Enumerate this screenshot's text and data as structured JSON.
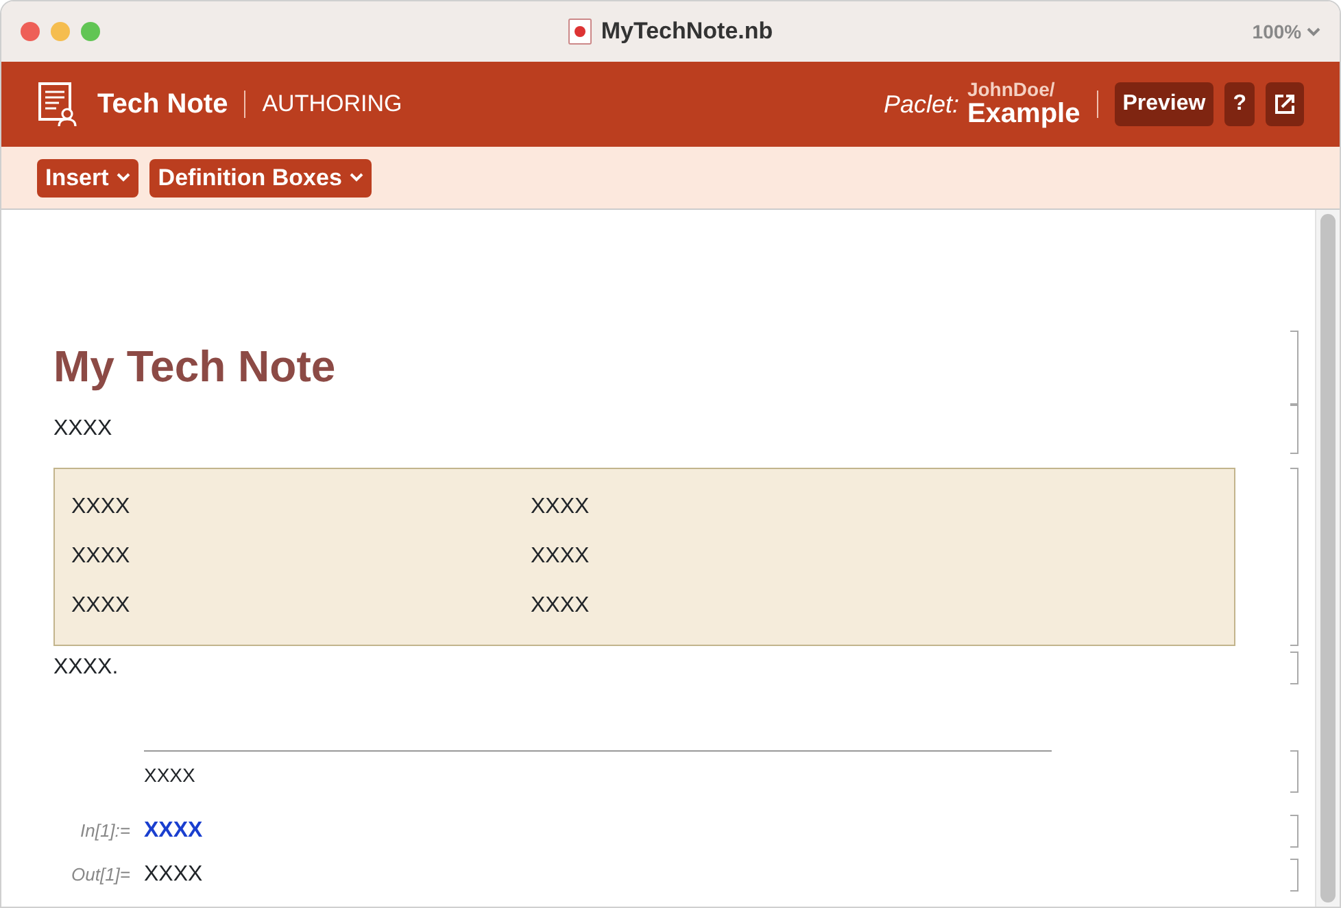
{
  "window": {
    "title": "MyTechNote.nb",
    "zoom": "100%"
  },
  "header": {
    "title": "Tech Note",
    "mode": "AUTHORING",
    "paclet_label": "Paclet:",
    "paclet_owner": "JohnDoe/",
    "paclet_name": "Example",
    "preview_button": "Preview",
    "help_button": "?"
  },
  "toolbar": {
    "menus": [
      "Insert",
      "Definition Boxes"
    ]
  },
  "notebook": {
    "title": "My Tech Note",
    "text": "XXXX",
    "definition_box": {
      "rows": [
        [
          "XXXX",
          "XXXX"
        ],
        [
          "XXXX",
          "XXXX"
        ],
        [
          "XXXX",
          "XXXX"
        ]
      ]
    },
    "caption": "XXXX.",
    "section_text": "XXXX",
    "input": {
      "label": "In[1]:=",
      "code": "XXXX"
    },
    "output": {
      "label": "Out[1]=",
      "value": "XXXX"
    }
  }
}
